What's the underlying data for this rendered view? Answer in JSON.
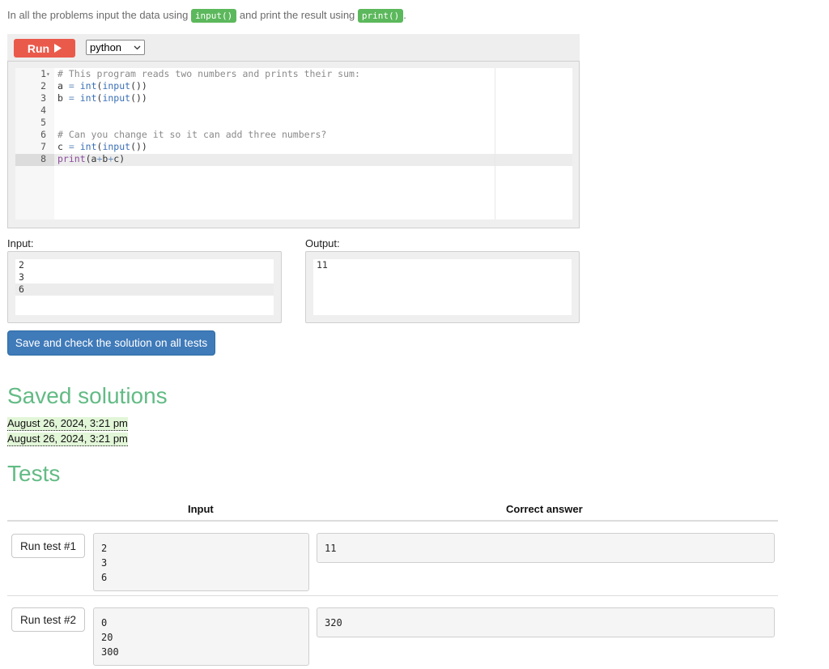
{
  "intro": {
    "part1": "In all the problems input the data using ",
    "input_code": "input()",
    "part2": " and print the result using ",
    "print_code": "print()",
    "part3": "."
  },
  "toolbar": {
    "run_label": "Run",
    "language": "python"
  },
  "editor": {
    "lines": [
      {
        "n": "1",
        "tokens": [
          {
            "c": "comment",
            "t": "# This program reads two numbers and prints their sum:"
          }
        ]
      },
      {
        "n": "2",
        "tokens": [
          {
            "c": "var",
            "t": "a "
          },
          {
            "c": "op",
            "t": "="
          },
          {
            "c": "var",
            "t": " "
          },
          {
            "c": "fn",
            "t": "int"
          },
          {
            "c": "punc",
            "t": "("
          },
          {
            "c": "fn",
            "t": "input"
          },
          {
            "c": "punc",
            "t": "())"
          }
        ]
      },
      {
        "n": "3",
        "tokens": [
          {
            "c": "var",
            "t": "b "
          },
          {
            "c": "op",
            "t": "="
          },
          {
            "c": "var",
            "t": " "
          },
          {
            "c": "fn",
            "t": "int"
          },
          {
            "c": "punc",
            "t": "("
          },
          {
            "c": "fn",
            "t": "input"
          },
          {
            "c": "punc",
            "t": "())"
          }
        ]
      },
      {
        "n": "4",
        "tokens": []
      },
      {
        "n": "5",
        "tokens": []
      },
      {
        "n": "6",
        "tokens": [
          {
            "c": "comment",
            "t": "# Can you change it so it can add three numbers?"
          }
        ]
      },
      {
        "n": "7",
        "tokens": [
          {
            "c": "var",
            "t": "c "
          },
          {
            "c": "op",
            "t": "="
          },
          {
            "c": "var",
            "t": " "
          },
          {
            "c": "fn",
            "t": "int"
          },
          {
            "c": "punc",
            "t": "("
          },
          {
            "c": "fn",
            "t": "input"
          },
          {
            "c": "punc",
            "t": "())"
          }
        ]
      },
      {
        "n": "8",
        "tokens": [
          {
            "c": "print",
            "t": "print"
          },
          {
            "c": "punc",
            "t": "(a"
          },
          {
            "c": "op",
            "t": "+"
          },
          {
            "c": "punc",
            "t": "b"
          },
          {
            "c": "op",
            "t": "+"
          },
          {
            "c": "punc",
            "t": "c)"
          }
        ]
      }
    ]
  },
  "io": {
    "input_label": "Input:",
    "output_label": "Output:",
    "input_lines": [
      "2",
      "3",
      "6"
    ],
    "output_lines": [
      "11"
    ]
  },
  "save_button": "Save and check the solution on all tests",
  "saved": {
    "heading": "Saved solutions",
    "items": [
      "August 26, 2024, 3:21 pm",
      "August 26, 2024, 3:21 pm"
    ]
  },
  "tests": {
    "heading": "Tests",
    "col_input": "Input",
    "col_answer": "Correct answer",
    "rows": [
      {
        "button": "Run test #1",
        "input": "2\n3\n6",
        "answer": "11"
      },
      {
        "button": "Run test #2",
        "input": "0\n20\n300",
        "answer": "320"
      }
    ]
  },
  "colors": {
    "run_button": "#ea5a4b",
    "save_button": "#3f7ab9",
    "heading": "#63bb85",
    "code_pill": "#5cb85c",
    "saved_highlight": "#e2f6d8"
  },
  "icons": {
    "run": "play-triangle-icon",
    "select": "chevron-down-icon",
    "fold": "fold-arrow-icon"
  }
}
